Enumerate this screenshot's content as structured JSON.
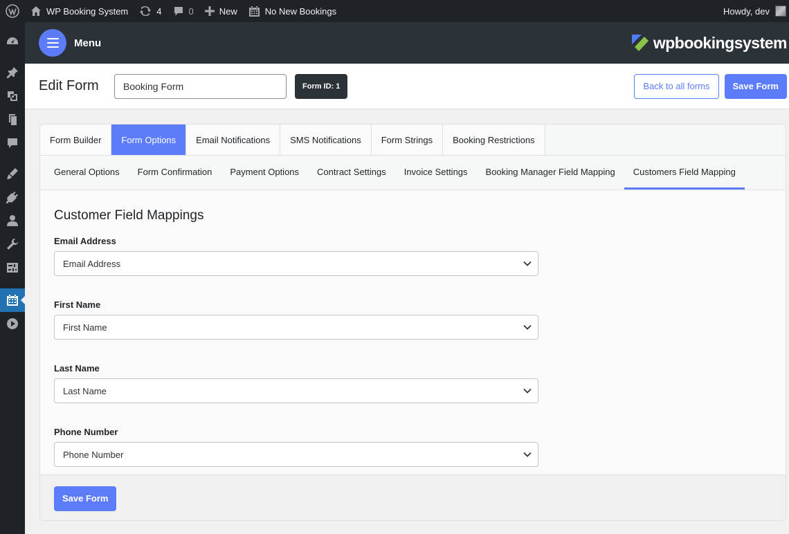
{
  "adminbar": {
    "site_name": "WP Booking System",
    "updates_count": "4",
    "comments_count": "0",
    "new_label": "New",
    "bookings_label": "No New Bookings",
    "howdy": "Howdy, dev"
  },
  "header": {
    "menu_label": "Menu",
    "brand_text": "wpbookingsystem"
  },
  "title_row": {
    "page_title": "Edit Form",
    "form_name_value": "Booking Form",
    "form_id": "Form ID: 1",
    "back_label": "Back to all forms",
    "save_label": "Save Form"
  },
  "tabs": [
    {
      "label": "Form Builder",
      "active": false
    },
    {
      "label": "Form Options",
      "active": true
    },
    {
      "label": "Email Notifications",
      "active": false
    },
    {
      "label": "SMS Notifications",
      "active": false
    },
    {
      "label": "Form Strings",
      "active": false
    },
    {
      "label": "Booking Restrictions",
      "active": false
    }
  ],
  "subtabs": [
    {
      "label": "General Options",
      "active": false
    },
    {
      "label": "Form Confirmation",
      "active": false
    },
    {
      "label": "Payment Options",
      "active": false
    },
    {
      "label": "Contract Settings",
      "active": false
    },
    {
      "label": "Invoice Settings",
      "active": false
    },
    {
      "label": "Booking Manager Field Mapping",
      "active": false
    },
    {
      "label": "Customers Field Mapping",
      "active": true
    }
  ],
  "section": {
    "title": "Customer Field Mappings",
    "fields": [
      {
        "label": "Email Address",
        "value": "Email Address"
      },
      {
        "label": "First Name",
        "value": "First Name"
      },
      {
        "label": "Last Name",
        "value": "Last Name"
      },
      {
        "label": "Phone Number",
        "value": "Phone Number"
      }
    ]
  },
  "footer": {
    "save_label": "Save Form"
  },
  "colors": {
    "accent": "#5c7cfa",
    "admin_dark": "#1d2327",
    "header_dark": "#2c3338",
    "brand_blue": "#4f7cff",
    "brand_green": "#8bc34a"
  },
  "admin_menu_icons": [
    "dashboard-icon",
    "pin-icon",
    "media-icon",
    "pages-icon",
    "comments-icon",
    "appearance-icon",
    "plugins-icon",
    "users-icon",
    "tools-icon",
    "settings-icon",
    "calendar-icon",
    "play-icon"
  ]
}
